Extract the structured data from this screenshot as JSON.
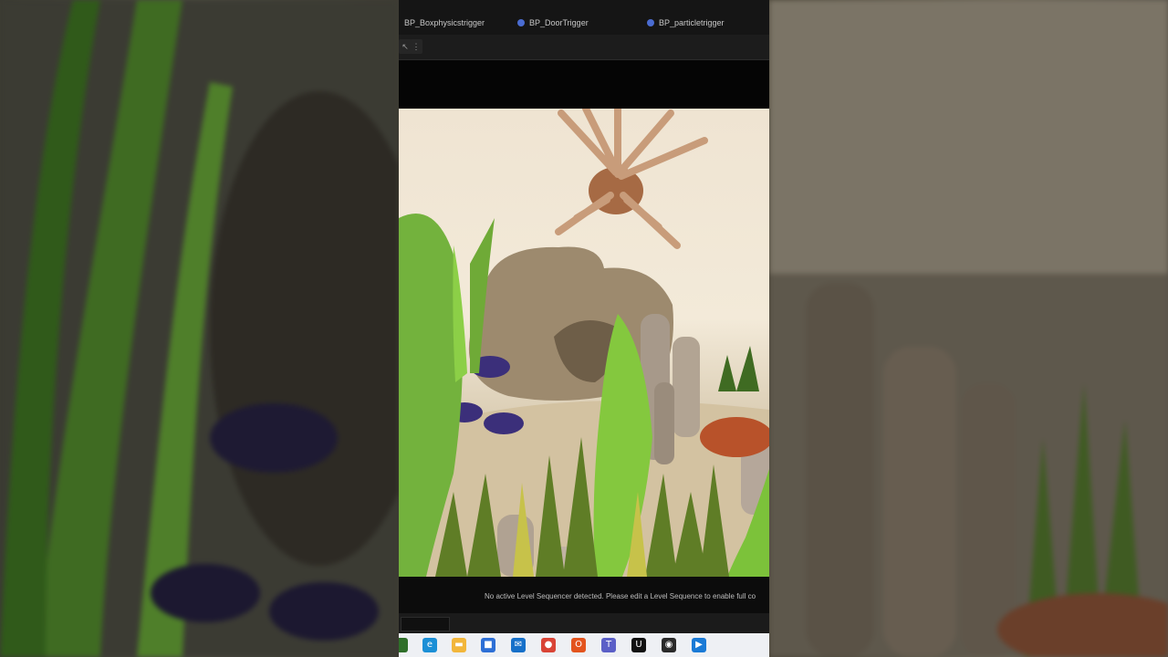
{
  "tabs": [
    {
      "label": "BP_Boxphysicstrigger"
    },
    {
      "label": "BP_DoorTrigger"
    },
    {
      "label": "BP_particletrigger"
    }
  ],
  "toolbar": {
    "select_icon": "cursor-icon",
    "more_icon": "more-vertical-icon"
  },
  "status": {
    "message": "No active Level Sequencer detected. Please edit a Level Sequence to enable full co"
  },
  "taskbar": {
    "icons": [
      {
        "name": "edge-icon",
        "glyph": "e",
        "color": "#1b8fd6"
      },
      {
        "name": "file-explorer-icon",
        "glyph": "▬",
        "color": "#f2b63b"
      },
      {
        "name": "store-icon",
        "glyph": "■",
        "color": "#2d6fd6"
      },
      {
        "name": "mail-icon",
        "glyph": "✉",
        "color": "#1670c9"
      },
      {
        "name": "chrome-icon",
        "glyph": "●",
        "color": "#d94436"
      },
      {
        "name": "office-icon",
        "glyph": "O",
        "color": "#e3541e"
      },
      {
        "name": "teams-icon",
        "glyph": "T",
        "color": "#5b5fc7"
      },
      {
        "name": "unreal-engine-icon",
        "glyph": "U",
        "color": "#111111"
      },
      {
        "name": "obs-icon",
        "glyph": "◉",
        "color": "#2a2a2a"
      },
      {
        "name": "media-player-icon",
        "glyph": "▶",
        "color": "#1a7ad6"
      }
    ]
  },
  "colors": {
    "editor_bg": "#151515",
    "sand": "#d9c9aa",
    "seaweed": "#7cc23a",
    "fish": "#3b2f7a"
  }
}
